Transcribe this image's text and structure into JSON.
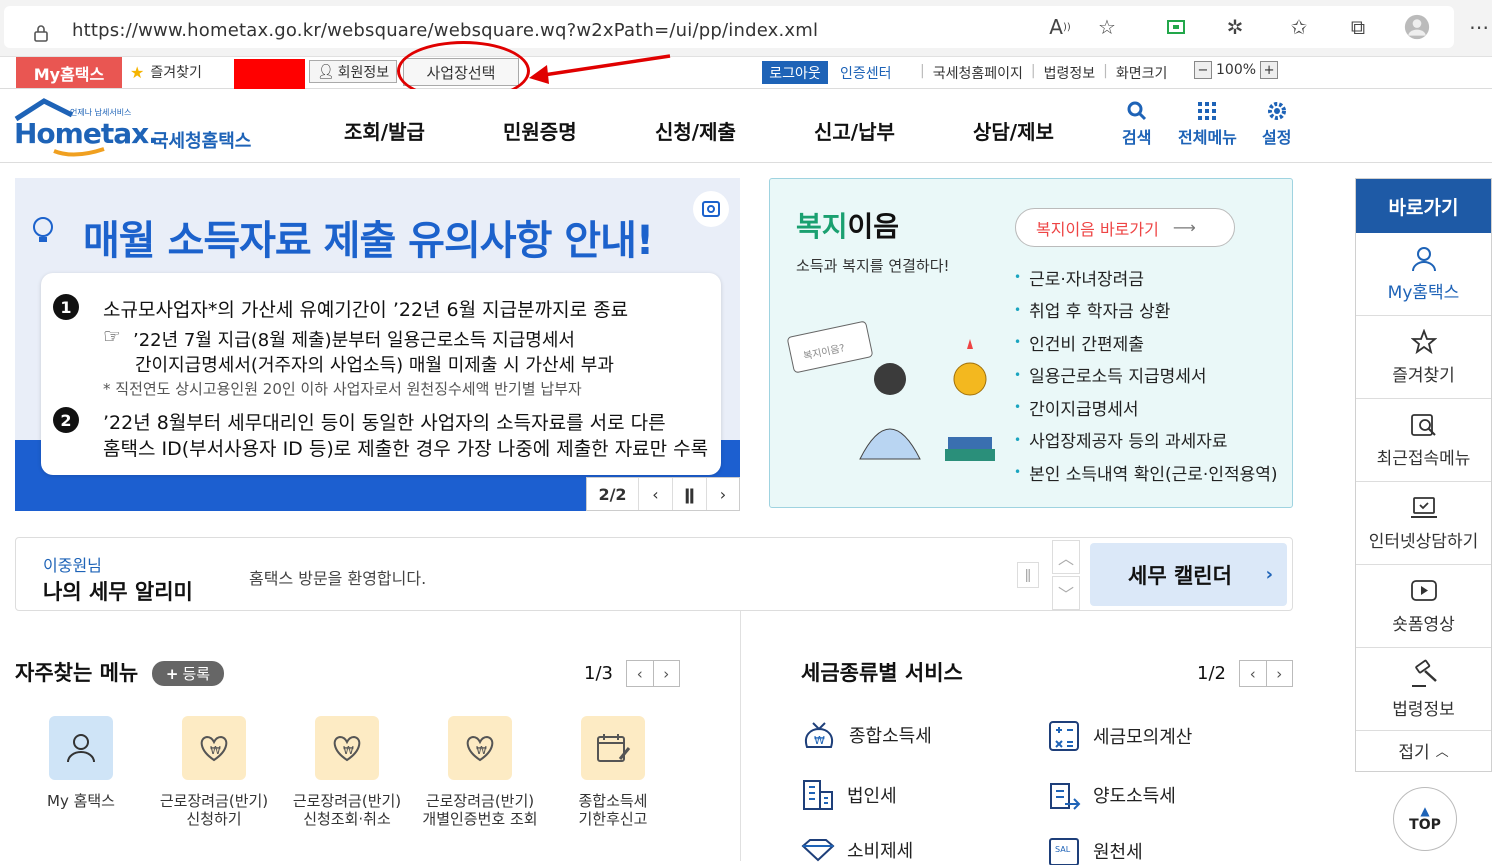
{
  "browser": {
    "url": "https://www.hometax.go.kr/websquare/websquare.wq?w2xPath=/ui/pp/index.xml"
  },
  "utilbar": {
    "my_hometax": "My홈택스",
    "favorites": "즐겨찾기",
    "member_info": "회원정보",
    "business_select": "사업장선택",
    "logout": "로그아웃",
    "cert_center": "인증센터",
    "links": [
      "국세청홈페이지",
      "법령정보",
      "화면크기"
    ],
    "zoom": "100%"
  },
  "header": {
    "logo_small": "언제나 납세서비스",
    "logo_main": "Hometax.",
    "logo_kor": "국세청홈택스",
    "nav": [
      "조회/발급",
      "민원증명",
      "신청/제출",
      "신고/납부",
      "상담/제보"
    ],
    "tools": [
      "검색",
      "전체메뉴",
      "설정"
    ]
  },
  "banner": {
    "title": "매월 소득자료 제출 유의사항 안내!",
    "line1": "소규모사업자*의 가산세 유예기간이 ’22년 6월 지급분까지로 종료",
    "line1a": "’22년 7월 지급(8월 제출)분부터 일용근로소득 지급명세서",
    "line1b": "간이지급명세서(거주자의 사업소득) 매월 미제출 시 가산세 부과",
    "line1c": "* 직전연도 상시고용인원 20인 이하 사업자로서 원천징수세액 반기별 납부자",
    "line2a": "’22년 8월부터 세무대리인 등이 동일한 사업자의 소득자료를 서로 다른",
    "line2b": "홈택스 ID(부서사용자 ID 등)로 제출한 경우 가장 나중에 제출한 자료만 수록",
    "num1": "1",
    "num2": "2",
    "page": "2/2"
  },
  "welfare": {
    "title_a": "복지",
    "title_b": "이음",
    "subtitle": "소득과 복지를 연결하다!",
    "button": "복지이음 바로가기",
    "items": [
      "근로·자녀장려금",
      "취업 후 학자금 상환",
      "인건비 간편제출",
      "일용근로소득 지급명세서",
      "간이지급명세서",
      "사업장제공자 등의 과세자료",
      "본인 소득내역 확인(근로·인적용역)"
    ]
  },
  "quick": {
    "title": "바로가기",
    "items": [
      "My홈택스",
      "즐겨찾기",
      "최근접속메뉴",
      "인터넷상담하기",
      "숏폼영상",
      "법령정보"
    ],
    "fold": "접기"
  },
  "top_button": "TOP",
  "alarm": {
    "name": "이중원님",
    "title": "나의 세무 알리미",
    "message": "홈택스 방문을 환영합니다.",
    "calendar": "세무 캘린더"
  },
  "freq_menu": {
    "title": "자주찾는 메뉴",
    "register": "등록",
    "page": "1/3",
    "items": [
      {
        "l1": "My 홈택스",
        "l2": ""
      },
      {
        "l1": "근로장려금(반기)",
        "l2": "신청하기"
      },
      {
        "l1": "근로장려금(반기)",
        "l2": "신청조회·취소"
      },
      {
        "l1": "근로장려금(반기)",
        "l2": "개별인증번호 조회"
      },
      {
        "l1": "종합소득세",
        "l2": "기한후신고"
      }
    ]
  },
  "tax_service": {
    "title": "세금종류별 서비스",
    "page": "1/2",
    "items": [
      "종합소득세",
      "세금모의계산",
      "법인세",
      "양도소득세",
      "소비제세",
      "원천세"
    ]
  },
  "colors": {
    "brand_blue": "#1e63b7",
    "my_red": "#e95652",
    "annotation_red": "#e00000"
  }
}
